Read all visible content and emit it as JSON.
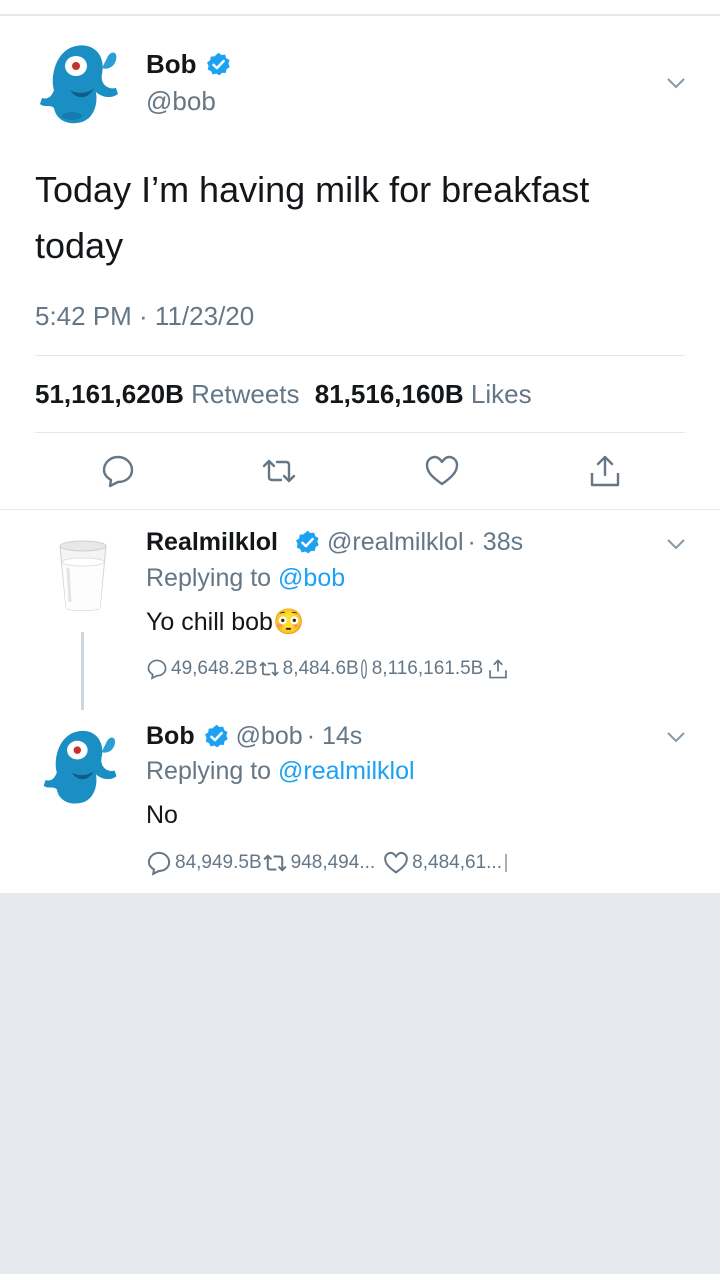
{
  "main_tweet": {
    "author_name": "Bob",
    "author_handle": "@bob",
    "text": "Today I’m having milk for breakfast today",
    "timestamp": "5:42 PM · 11/23/20",
    "retweets_count": "51,161,620B",
    "retweets_label": "Retweets",
    "likes_count": "81,516,160B",
    "likes_label": "Likes"
  },
  "replies": [
    {
      "author_name": "Realmilklol",
      "author_handle": "@realmilklol",
      "time": "· 38s",
      "replying_prefix": "Replying to ",
      "replying_to": "@bob",
      "text": "Yo chill bob😳",
      "reply_count": "49,648.2B",
      "retweet_count": "8,484.6B",
      "like_count": "8,116,161.5B"
    },
    {
      "author_name": "Bob",
      "author_handle": "@bob",
      "time": "· 14s",
      "replying_prefix": "Replying to ",
      "replying_to": "@realmilklol",
      "text": "No",
      "reply_count": "84,949.5B",
      "retweet_count": "948,494...",
      "like_count": "8,484,61..."
    }
  ],
  "colors": {
    "accent": "#1da1f2",
    "text": "#14171a",
    "secondary": "#657786",
    "divider": "#e6e9ec",
    "background_gray": "#e6e9ee"
  },
  "icons": [
    "blob-avatar",
    "milk-glass-avatar",
    "verified-badge-icon",
    "chevron-down-icon",
    "reply-icon",
    "retweet-icon",
    "like-icon",
    "share-icon"
  ]
}
